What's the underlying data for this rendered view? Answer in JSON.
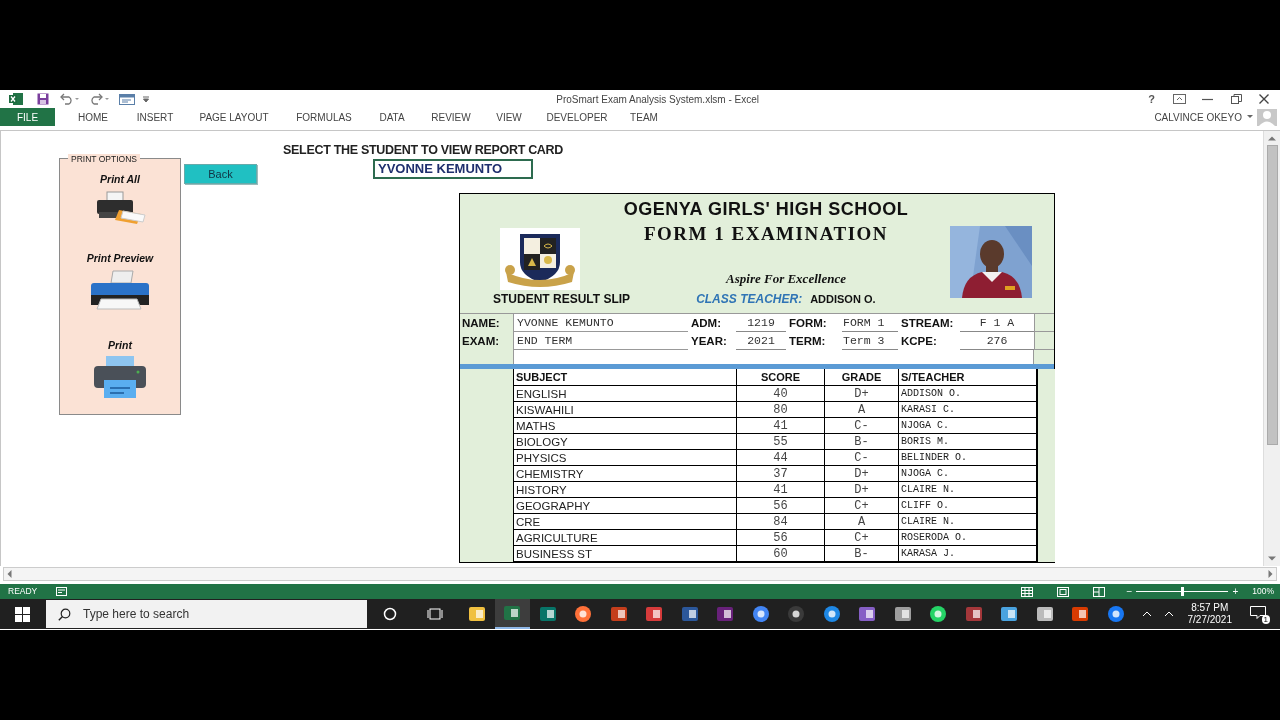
{
  "excel": {
    "title": "ProSmart Exam Analysis System.xlsm - Excel",
    "help": "?",
    "user": "CALVINCE OKEYO",
    "ribbon_tabs": [
      {
        "label": "FILE",
        "selected": true
      },
      {
        "label": "HOME",
        "selected": false
      },
      {
        "label": "INSERT",
        "selected": false
      },
      {
        "label": "PAGE LAYOUT",
        "selected": false
      },
      {
        "label": "FORMULAS",
        "selected": false
      },
      {
        "label": "DATA",
        "selected": false
      },
      {
        "label": "REVIEW",
        "selected": false
      },
      {
        "label": "VIEW",
        "selected": false
      },
      {
        "label": "DEVELOPER",
        "selected": false
      },
      {
        "label": "TEAM",
        "selected": false
      }
    ]
  },
  "sheet": {
    "heading": "SELECT THE STUDENT TO VIEW REPORT CARD",
    "selected_student": "YVONNE KEMUNTO",
    "back_button": "Back",
    "print_options": {
      "title": "PRINT OPTIONS",
      "items": [
        {
          "label": "Print All",
          "kind": "all"
        },
        {
          "label": "Print Preview",
          "kind": "preview"
        },
        {
          "label": "Print",
          "kind": "print"
        }
      ]
    },
    "report": {
      "school": "OGENYA GIRLS' HIGH SCHOOL",
      "exam_title": "FORM 1 EXAMINATION",
      "motto": "Aspire For Excellence",
      "slip_label": "STUDENT RESULT SLIP",
      "class_teacher_label": "CLASS TEACHER:",
      "class_teacher": "ADDISON O.",
      "fields": [
        {
          "label": "NAME:",
          "value": "YVONNE KEMUNTO"
        },
        {
          "label": "ADM:",
          "value": "1219"
        },
        {
          "label": "FORM:",
          "value": "FORM 1"
        },
        {
          "label": "STREAM:",
          "value": "F 1 A"
        },
        {
          "label": "EXAM:",
          "value": "END TERM"
        },
        {
          "label": "YEAR:",
          "value": "2021"
        },
        {
          "label": "TERM:",
          "value": "Term 3"
        },
        {
          "label": "KCPE:",
          "value": "276"
        }
      ],
      "columns": [
        "SUBJECT",
        "SCORE",
        "GRADE",
        "S/TEACHER"
      ],
      "rows": [
        [
          "ENGLISH",
          "40",
          "D+",
          "ADDISON O."
        ],
        [
          "KISWAHILI",
          "80",
          "A",
          "KARASI C."
        ],
        [
          "MATHS",
          "41",
          "C-",
          "NJOGA C."
        ],
        [
          "BIOLOGY",
          "55",
          "B-",
          "BORIS M."
        ],
        [
          "PHYSICS",
          "44",
          "C-",
          "BELINDER O."
        ],
        [
          "CHEMISTRY",
          "37",
          "D+",
          "NJOGA C."
        ],
        [
          "HISTORY",
          "41",
          "D+",
          "CLAIRE N."
        ],
        [
          "GEOGRAPHY",
          "56",
          "C+",
          "CLIFF O."
        ],
        [
          "CRE",
          "84",
          "A",
          "CLAIRE N."
        ],
        [
          "AGRICULTURE",
          "56",
          "C+",
          "ROSERODA O."
        ],
        [
          "BUSINESS ST",
          "60",
          "B-",
          "KARASA J."
        ]
      ]
    }
  },
  "status_bar": {
    "status": "READY",
    "zoom_out": "−",
    "zoom_in": "+",
    "zoom": {
      "level": 0.5,
      "reading": "100%"
    }
  },
  "taskbar": {
    "search_placeholder": "Type here to search",
    "time": "8:57 PM",
    "date": "7/27/2021",
    "notifications": "1",
    "apps": [
      {
        "selected": false
      },
      {
        "selected": true
      },
      {
        "selected": false
      },
      {
        "selected": false
      },
      {
        "selected": false
      },
      {
        "selected": false
      },
      {
        "selected": false
      },
      {
        "selected": false
      },
      {
        "selected": false
      },
      {
        "selected": false
      },
      {
        "selected": false
      },
      {
        "selected": false
      },
      {
        "selected": false
      },
      {
        "selected": false
      },
      {
        "selected": false
      },
      {
        "selected": false
      },
      {
        "selected": false
      },
      {
        "selected": false
      },
      {
        "selected": false
      }
    ]
  }
}
